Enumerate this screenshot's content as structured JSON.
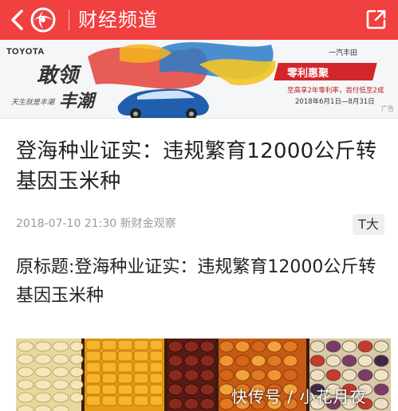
{
  "topbar": {
    "channel_title": "财经频道",
    "colors": {
      "background": "#f0403f",
      "foreground": "#ffffff"
    },
    "icons": {
      "back": "chevron-left-icon",
      "logo": "ifeng-logo-icon",
      "share": "share-out-icon"
    }
  },
  "ad": {
    "brand": "TOYOTA",
    "slogan_line1": "敢领",
    "slogan_line2": "丰潮",
    "tagline": "天生就是丰潮",
    "promo_title": "零利惠聚",
    "promo_sub": "至高享2年零利率，首付低至2成",
    "promo_date": "2018年6月1日—8月31日",
    "right_brand": "一汽丰田",
    "tag": "广告"
  },
  "article": {
    "headline": "登海种业证实：违规繁育12000公斤转基因玉米种",
    "timestamp": "2018-07-10 21:30",
    "source": "新财金观察",
    "font_button": "T大",
    "body": "原标题:登海种业证实：违规繁育12000公斤转基因玉米种"
  },
  "photo": {
    "watermark": "快传号 / 小花月夜"
  }
}
